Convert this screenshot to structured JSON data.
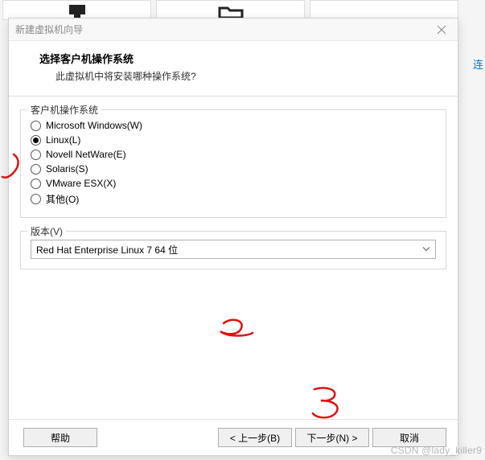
{
  "background": {
    "side_link": "连"
  },
  "dialog": {
    "title": "新建虚拟机向导",
    "header": {
      "title": "选择客户机操作系统",
      "subtitle": "此虚拟机中将安装哪种操作系统?"
    },
    "os_group": {
      "legend": "客户机操作系统",
      "options": [
        {
          "label": "Microsoft Windows(W)",
          "selected": false
        },
        {
          "label": "Linux(L)",
          "selected": true
        },
        {
          "label": "Novell NetWare(E)",
          "selected": false
        },
        {
          "label": "Solaris(S)",
          "selected": false
        },
        {
          "label": "VMware ESX(X)",
          "selected": false
        },
        {
          "label": "其他(O)",
          "selected": false
        }
      ]
    },
    "version_group": {
      "label": "版本(V)",
      "selected": "Red Hat Enterprise Linux 7 64 位"
    },
    "footer": {
      "help": "帮助",
      "back": "< 上一步(B)",
      "next": "下一步(N) >",
      "cancel": "取消"
    }
  },
  "annotations": {
    "two": "2",
    "three": "3"
  },
  "watermark": "CSDN @lady_killer9"
}
